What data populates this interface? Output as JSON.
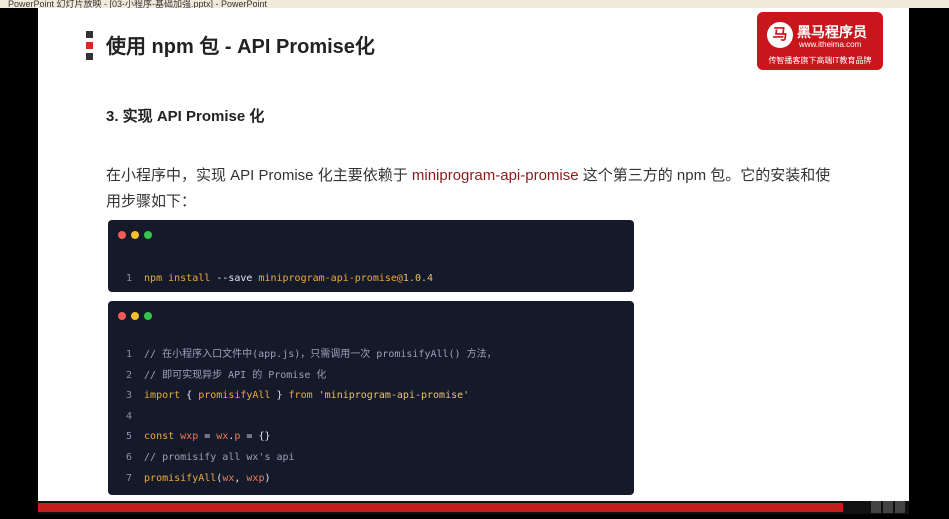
{
  "window": {
    "title": "PowerPoint 幻灯片放映 - [03-小程序-基础加强.pptx] - PowerPoint"
  },
  "slide": {
    "title": "使用 npm 包 - API Promise化",
    "section_heading": "3. 实现 API Promise 化",
    "paragraph": {
      "before": "在小程序中，实现 API Promise 化主要依赖于 ",
      "package": "miniprogram-api-promise",
      "after": " 这个第三方的 npm 包。它的安装和使用步骤如下："
    },
    "logo": {
      "name": "黑马程序员",
      "url": "www.itheima.com",
      "slogan": "传智播客旗下高端IT教育品牌"
    }
  },
  "code_block_1": {
    "lines": [
      {
        "n": "1",
        "t1": "npm install ",
        "t2": "--save",
        "t3": " miniprogram-api-promise@",
        "t4": "1.0.4"
      }
    ]
  },
  "code_block_2": {
    "lines": [
      {
        "n": "1",
        "t": "// 在小程序入口文件中(app.js)，只需调用一次 promisifyAll() 方法，"
      },
      {
        "n": "2",
        "t": "// 即可实现异步 API 的 Promise 化"
      },
      {
        "n": "3",
        "kw1": "import",
        "p1": " { ",
        "fn": "promisifyAll",
        "p2": " } ",
        "kw2": "from",
        "s": " 'miniprogram-api-promise'"
      },
      {
        "n": "4"
      },
      {
        "n": "5",
        "kw": "const",
        "v1": " wxp",
        "p1": " = ",
        "v2": "wx",
        "p2": ".",
        "v3": "p",
        "p3": " = {}"
      },
      {
        "n": "6",
        "t": "// promisify all wx's api"
      },
      {
        "n": "7",
        "fn": "promisifyAll",
        "p1": "(",
        "a1": "wx",
        "p2": ", ",
        "a2": "wxp",
        "p3": ")"
      }
    ]
  },
  "colors": {
    "brand_red": "#c9161d",
    "code_bg": "#151a2a",
    "package_text": "#8b1b1b"
  },
  "slideshow": {
    "progress": 0.97
  }
}
